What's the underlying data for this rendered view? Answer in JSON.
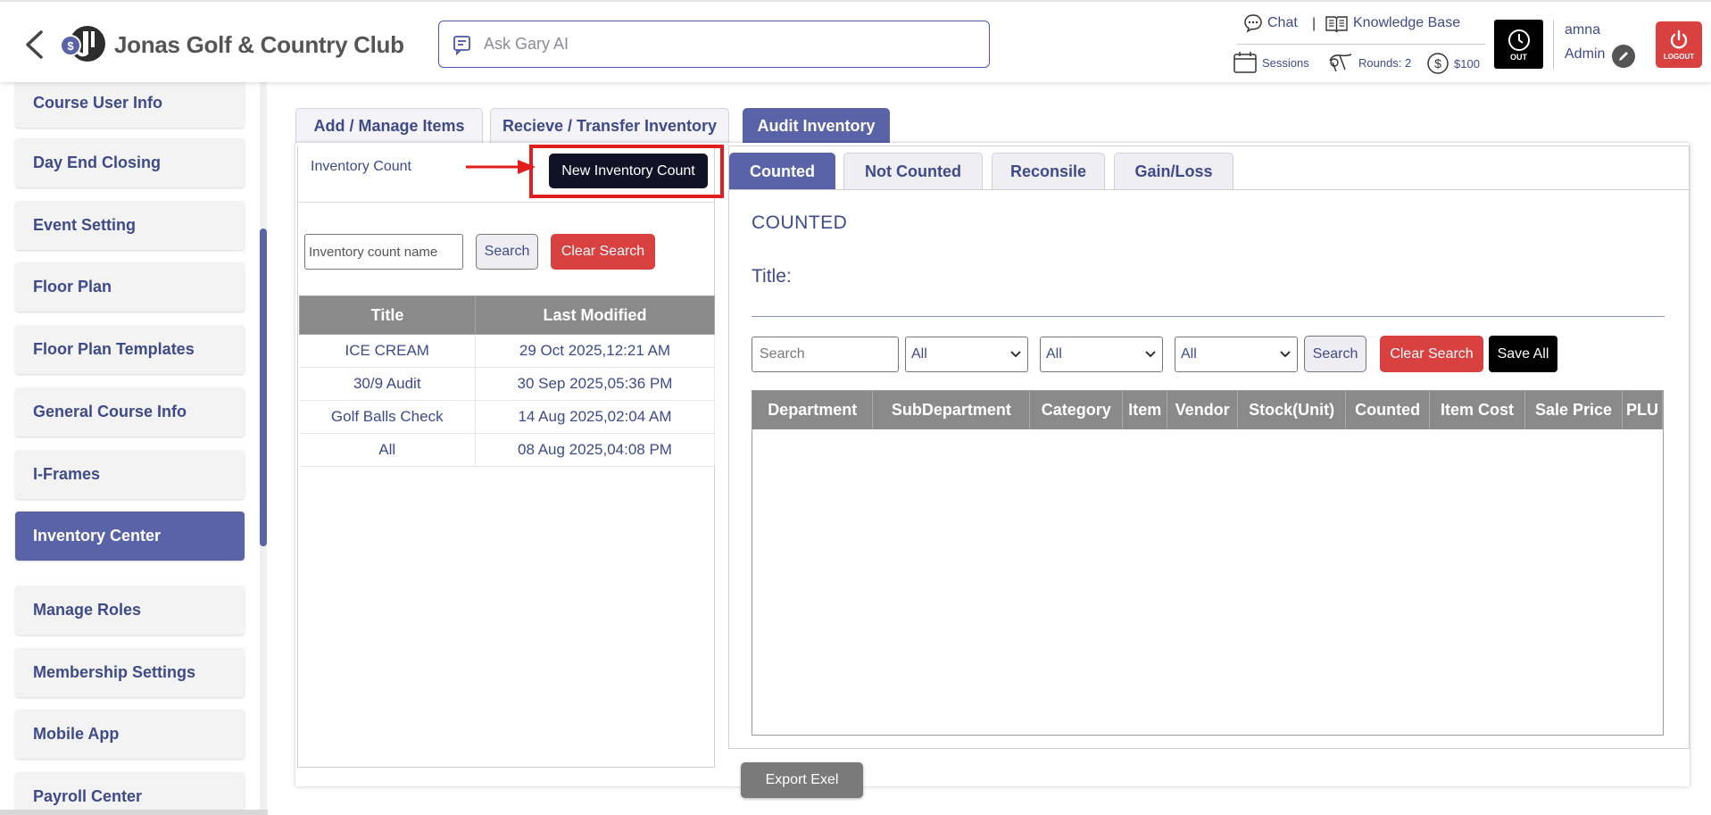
{
  "header": {
    "club_name": "Jonas Golf & Country Club",
    "ask_placeholder": "Ask Gary AI",
    "chat_label": "Chat",
    "separator": "|",
    "kb_label": "Knowledge Base",
    "sessions_label": "Sessions",
    "rounds_label": "Rounds: 2",
    "balance_label": "$100",
    "out_label": "OUT",
    "user_name": "amna",
    "user_role": "Admin",
    "logout_label": "LOGOUT"
  },
  "sidebar": {
    "items": [
      {
        "label": "Course User Info"
      },
      {
        "label": "Day End Closing"
      },
      {
        "label": "Event Setting"
      },
      {
        "label": "Floor Plan"
      },
      {
        "label": "Floor Plan Templates"
      },
      {
        "label": "General Course Info"
      },
      {
        "label": "I-Frames"
      },
      {
        "label": "Inventory Center",
        "active": true
      },
      {
        "label": "Manage Roles"
      },
      {
        "label": "Membership Settings"
      },
      {
        "label": "Mobile App"
      },
      {
        "label": "Payroll Center"
      }
    ]
  },
  "main_tabs": [
    {
      "label": "Add / Manage Items"
    },
    {
      "label": "Recieve / Transfer Inventory"
    },
    {
      "label": "Audit Inventory",
      "active": true
    }
  ],
  "left_panel": {
    "label": "Inventory Count",
    "new_button": "New Inventory Count",
    "search_placeholder": "Inventory count name",
    "search_button": "Search",
    "clear_button": "Clear Search",
    "columns": [
      "Title",
      "Last Modified"
    ],
    "rows": [
      [
        "ICE CREAM",
        "29 Oct 2025,12:21 AM"
      ],
      [
        "30/9 Audit",
        "30 Sep 2025,05:36 PM"
      ],
      [
        "Golf Balls Check",
        "14 Aug 2025,02:04 AM"
      ],
      [
        "All",
        "08 Aug 2025,04:08 PM"
      ]
    ]
  },
  "sub_tabs": [
    {
      "label": "Counted",
      "active": true
    },
    {
      "label": "Not Counted"
    },
    {
      "label": "Reconsile"
    },
    {
      "label": "Gain/Loss"
    }
  ],
  "right_panel": {
    "heading": "COUNTED",
    "title_label": "Title:",
    "search_placeholder": "Search",
    "filters": [
      "All",
      "All",
      "All"
    ],
    "search_button": "Search",
    "clear_button": "Clear Search",
    "save_all": "Save All",
    "columns": [
      "Department",
      "SubDepartment",
      "Category",
      "Item",
      "Vendor",
      "Stock(Unit)",
      "Counted",
      "Item Cost",
      "Sale Price",
      "PLU"
    ]
  },
  "export_button": "Export Exel",
  "colors": {
    "accent": "#5a63a8",
    "text": "#3e4a8a",
    "danger": "#d94040",
    "highlight_box": "#e21d1d",
    "table_header": "#8a8a8a"
  },
  "icons": [
    "back-arrow-icon",
    "club-logo-icon",
    "ask-ai-icon",
    "chat-icon",
    "knowledge-base-icon",
    "sessions-icon",
    "rounds-icon",
    "dollar-icon",
    "clock-icon",
    "edit-icon",
    "power-icon",
    "chevron-down-icon",
    "red-arrow-icon"
  ]
}
